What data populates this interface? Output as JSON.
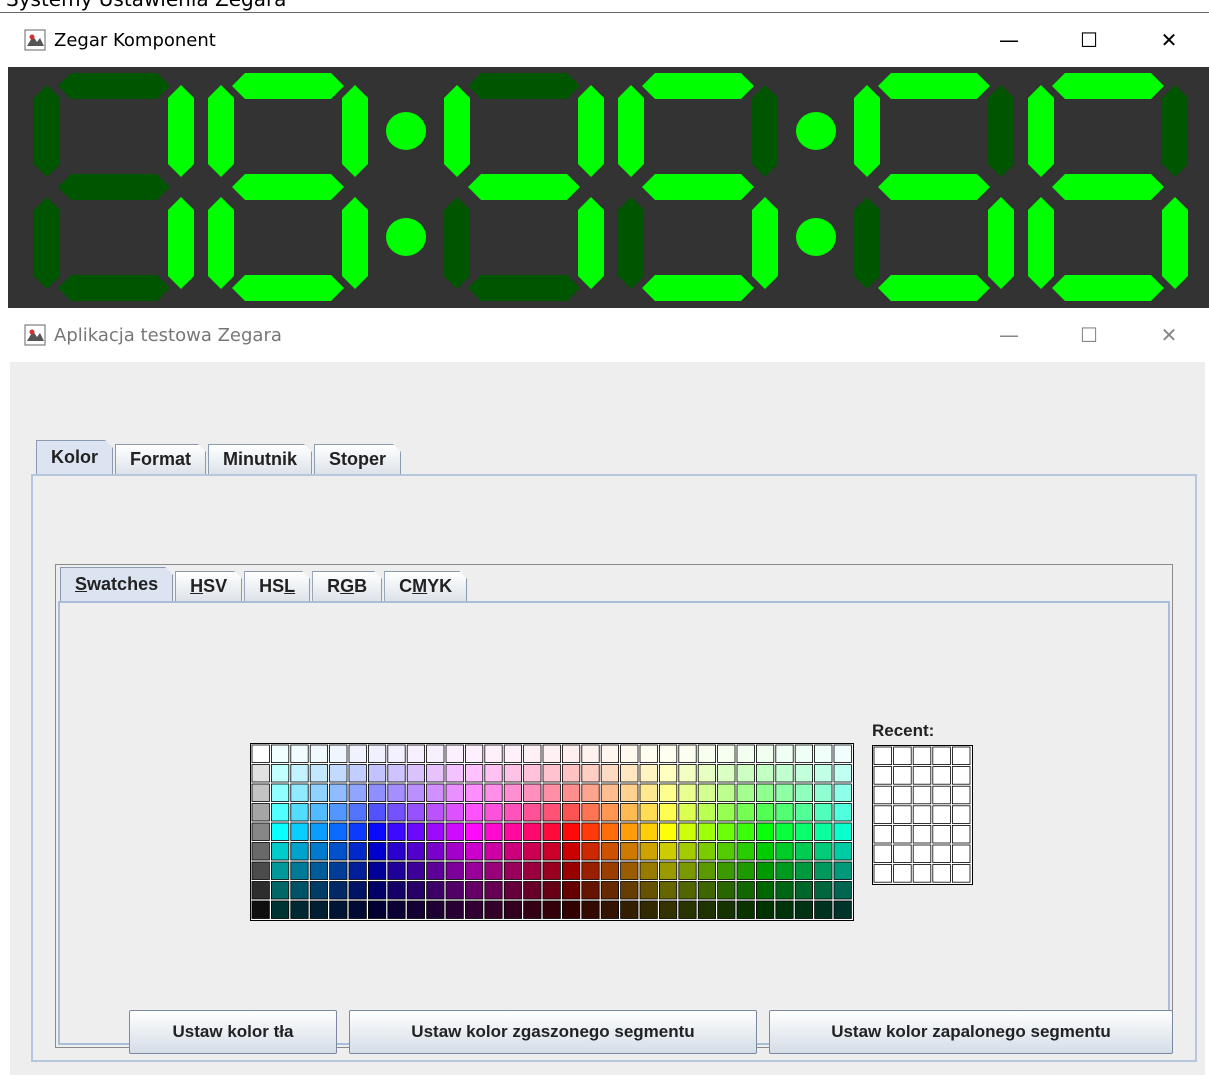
{
  "clock_window": {
    "title": "Zegar Komponent",
    "controls": {
      "minimize": "—",
      "maximize": "☐",
      "close": "✕"
    },
    "time": "18:45:56",
    "colors": {
      "background": "#333333",
      "lit": "#00ff00",
      "unlit": "#005500"
    }
  },
  "app_window": {
    "title": "Aplikacja testowa Zegara",
    "controls": {
      "minimize": "—",
      "maximize": "☐",
      "close": "✕"
    },
    "main_tabs": [
      {
        "label": "Kolor",
        "selected": true
      },
      {
        "label": "Format",
        "selected": false
      },
      {
        "label": "Minutnik",
        "selected": false
      },
      {
        "label": "Stoper",
        "selected": false
      }
    ],
    "color_tabs": [
      {
        "label": "Swatches",
        "mnemonic": "S",
        "selected": true
      },
      {
        "label": "HSV",
        "mnemonic": "H",
        "selected": false
      },
      {
        "label": "HSL",
        "mnemonic": "L",
        "selected": false
      },
      {
        "label": "RGB",
        "mnemonic": "G",
        "selected": false
      },
      {
        "label": "CMYK",
        "mnemonic": "M",
        "selected": false
      }
    ],
    "recent_label": "Recent:",
    "buttons": {
      "bg": "Ustaw kolor tła",
      "off": "Ustaw kolor zgaszonego segmentu",
      "on": "Ustaw kolor zapalonego segmentu"
    }
  }
}
